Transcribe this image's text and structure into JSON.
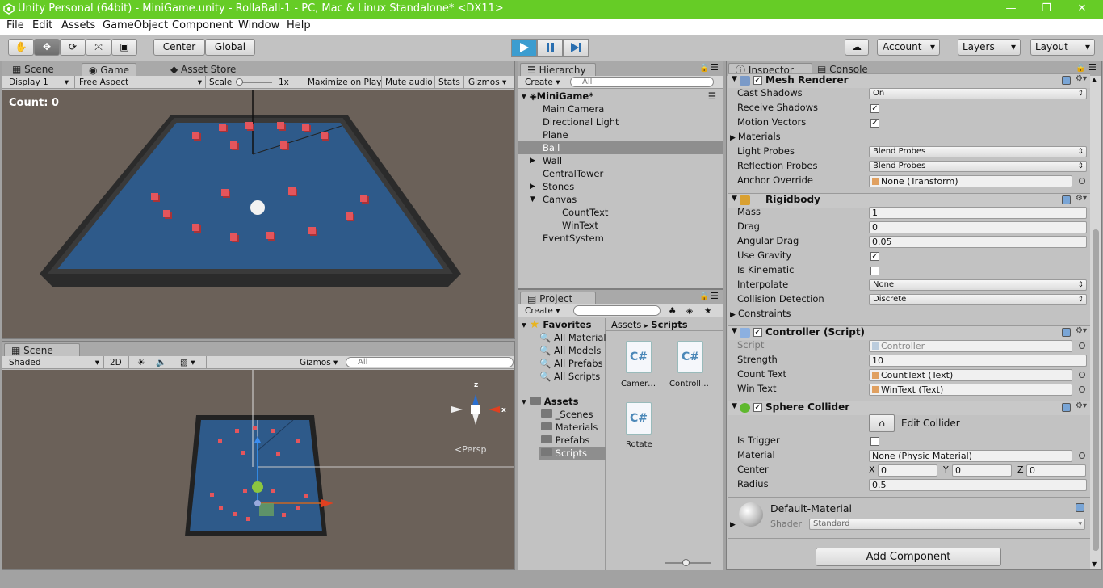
{
  "window": {
    "title": "Unity Personal (64bit) - MiniGame.unity - RollaBall-1 - PC, Mac & Linux Standalone* <DX11>",
    "minimize": "—",
    "restore": "❐",
    "close": "✕"
  },
  "menu": [
    "File",
    "Edit",
    "Assets",
    "GameObject",
    "Component",
    "Window",
    "Help"
  ],
  "toolbar": {
    "center": "Center",
    "global": "Global",
    "account": "Account",
    "layers": "Layers",
    "layout": "Layout"
  },
  "game_panel": {
    "tabs": [
      "Scene",
      "Game",
      "Asset Store"
    ],
    "display": "Display 1",
    "aspect": "Free Aspect",
    "scale_label": "Scale",
    "scale_value": "1x",
    "maximize": "Maximize on Play",
    "mute": "Mute audio",
    "stats": "Stats",
    "gizmos": "Gizmos",
    "count_text": "Count: 0"
  },
  "scene_panel": {
    "tab": "Scene",
    "shading": "Shaded",
    "mode2d": "2D",
    "gizmos": "Gizmos",
    "search_placeholder": "All",
    "persp": "Persp",
    "axes": {
      "z": "z",
      "x": "x"
    }
  },
  "hierarchy": {
    "tab": "Hierarchy",
    "create": "Create",
    "search_placeholder": "All",
    "scene": "MiniGame*",
    "items": [
      {
        "label": "Main Camera",
        "depth": 1,
        "arrow": false
      },
      {
        "label": "Directional Light",
        "depth": 1,
        "arrow": false
      },
      {
        "label": "Plane",
        "depth": 1,
        "arrow": false
      },
      {
        "label": "Ball",
        "depth": 1,
        "arrow": false,
        "selected": true
      },
      {
        "label": "Wall",
        "depth": 1,
        "arrow": true
      },
      {
        "label": "CentralTower",
        "depth": 1,
        "arrow": false
      },
      {
        "label": "Stones",
        "depth": 1,
        "arrow": true
      },
      {
        "label": "Canvas",
        "depth": 1,
        "arrow": true,
        "open": true
      },
      {
        "label": "CountText",
        "depth": 2,
        "arrow": false
      },
      {
        "label": "WinText",
        "depth": 2,
        "arrow": false
      },
      {
        "label": "EventSystem",
        "depth": 1,
        "arrow": false
      }
    ]
  },
  "project": {
    "tab": "Project",
    "create": "Create",
    "favorites_label": "Favorites",
    "favorites": [
      "All Material",
      "All Models",
      "All Prefabs",
      "All Scripts"
    ],
    "assets_label": "Assets",
    "folders": [
      "_Scenes",
      "Materials",
      "Prefabs",
      "Scripts"
    ],
    "breadcrumb": [
      "Assets",
      "Scripts"
    ],
    "breadcrumb_sep": "▸",
    "files": [
      "Camer…",
      "Controll…",
      "Rotate"
    ],
    "file_icon": "C#"
  },
  "inspector": {
    "tabs": [
      "Inspector",
      "Console"
    ],
    "mesh_renderer": {
      "title": "Mesh Renderer",
      "rows": [
        {
          "label": "Cast Shadows",
          "type": "dropdown",
          "value": "On"
        },
        {
          "label": "Receive Shadows",
          "type": "check",
          "value": "✓"
        },
        {
          "label": "Motion Vectors",
          "type": "check",
          "value": "✓"
        },
        {
          "label": "Materials",
          "type": "foldout",
          "value": ""
        },
        {
          "label": "Light Probes",
          "type": "dropdown",
          "value": "Blend Probes"
        },
        {
          "label": "Reflection Probes",
          "type": "dropdown",
          "value": "Blend Probes"
        },
        {
          "label": "Anchor Override",
          "type": "object",
          "value": "None (Transform)"
        }
      ]
    },
    "rigidbody": {
      "title": "Rigidbody",
      "rows": [
        {
          "label": "Mass",
          "type": "field",
          "value": "1"
        },
        {
          "label": "Drag",
          "type": "field",
          "value": "0"
        },
        {
          "label": "Angular Drag",
          "type": "field",
          "value": "0.05"
        },
        {
          "label": "Use Gravity",
          "type": "check",
          "value": "✓"
        },
        {
          "label": "Is Kinematic",
          "type": "check",
          "value": ""
        },
        {
          "label": "Interpolate",
          "type": "dropdown",
          "value": "None"
        },
        {
          "label": "Collision Detection",
          "type": "dropdown",
          "value": "Discrete"
        },
        {
          "label": "Constraints",
          "type": "foldout",
          "value": ""
        }
      ]
    },
    "controller": {
      "title": "Controller (Script)",
      "rows": [
        {
          "label": "Script",
          "type": "object",
          "value": "Controller"
        },
        {
          "label": "Strength",
          "type": "field",
          "value": "10"
        },
        {
          "label": "Count Text",
          "type": "object",
          "value": "CountText (Text)"
        },
        {
          "label": "Win Text",
          "type": "object",
          "value": "WinText (Text)"
        }
      ]
    },
    "sphere_collider": {
      "title": "Sphere Collider",
      "edit_collider": "Edit Collider",
      "is_trigger": "Is Trigger",
      "material_label": "Material",
      "material_value": "None (Physic Material)",
      "center_label": "Center",
      "center": {
        "x": "0",
        "y": "0",
        "z": "0"
      },
      "axis_x": "X",
      "axis_y": "Y",
      "axis_z": "Z",
      "radius_label": "Radius",
      "radius_value": "0.5"
    },
    "material": {
      "name": "Default-Material",
      "shader_label": "Shader",
      "shader_value": "Standard"
    },
    "add_component": "Add Component"
  },
  "colors": {
    "title_green": "#66cc26",
    "play_blue": "#3c9dd0",
    "plane_blue": "#2e5a8a",
    "cube_red": "#e4555c"
  }
}
